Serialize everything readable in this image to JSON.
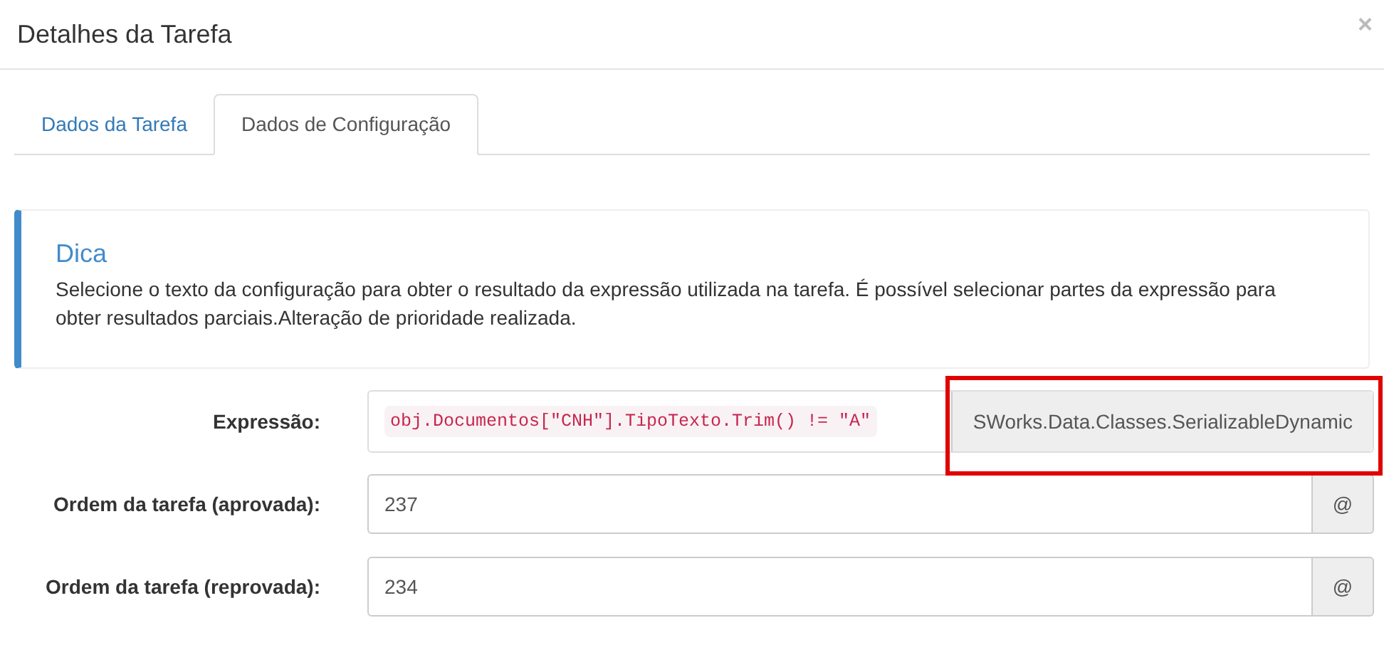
{
  "dialog": {
    "title": "Detalhes da Tarefa",
    "close": "×"
  },
  "tabs": [
    {
      "label": "Dados da Tarefa",
      "selected": false
    },
    {
      "label": "Dados de Configuração",
      "selected": true
    }
  ],
  "tip": {
    "title": "Dica",
    "text": "Selecione o texto da configuração para obter o resultado da expressão utilizada na tarefa. É possível selecionar partes da expressão para obter resultados parciais.Alteração de prioridade realizada."
  },
  "expression": {
    "label": "Expressão:",
    "code": "obj.Documentos[\"CNH\"].TipoTexto.Trim() != \"A\"",
    "result": "SWorks.Data.Classes.SerializableDynamic",
    "highlighted": true
  },
  "fields": [
    {
      "label": "Ordem da tarefa (aprovada):",
      "value": "237",
      "addon": "@"
    },
    {
      "label": "Ordem da tarefa (reprovada):",
      "value": "234",
      "addon": "@"
    }
  ]
}
